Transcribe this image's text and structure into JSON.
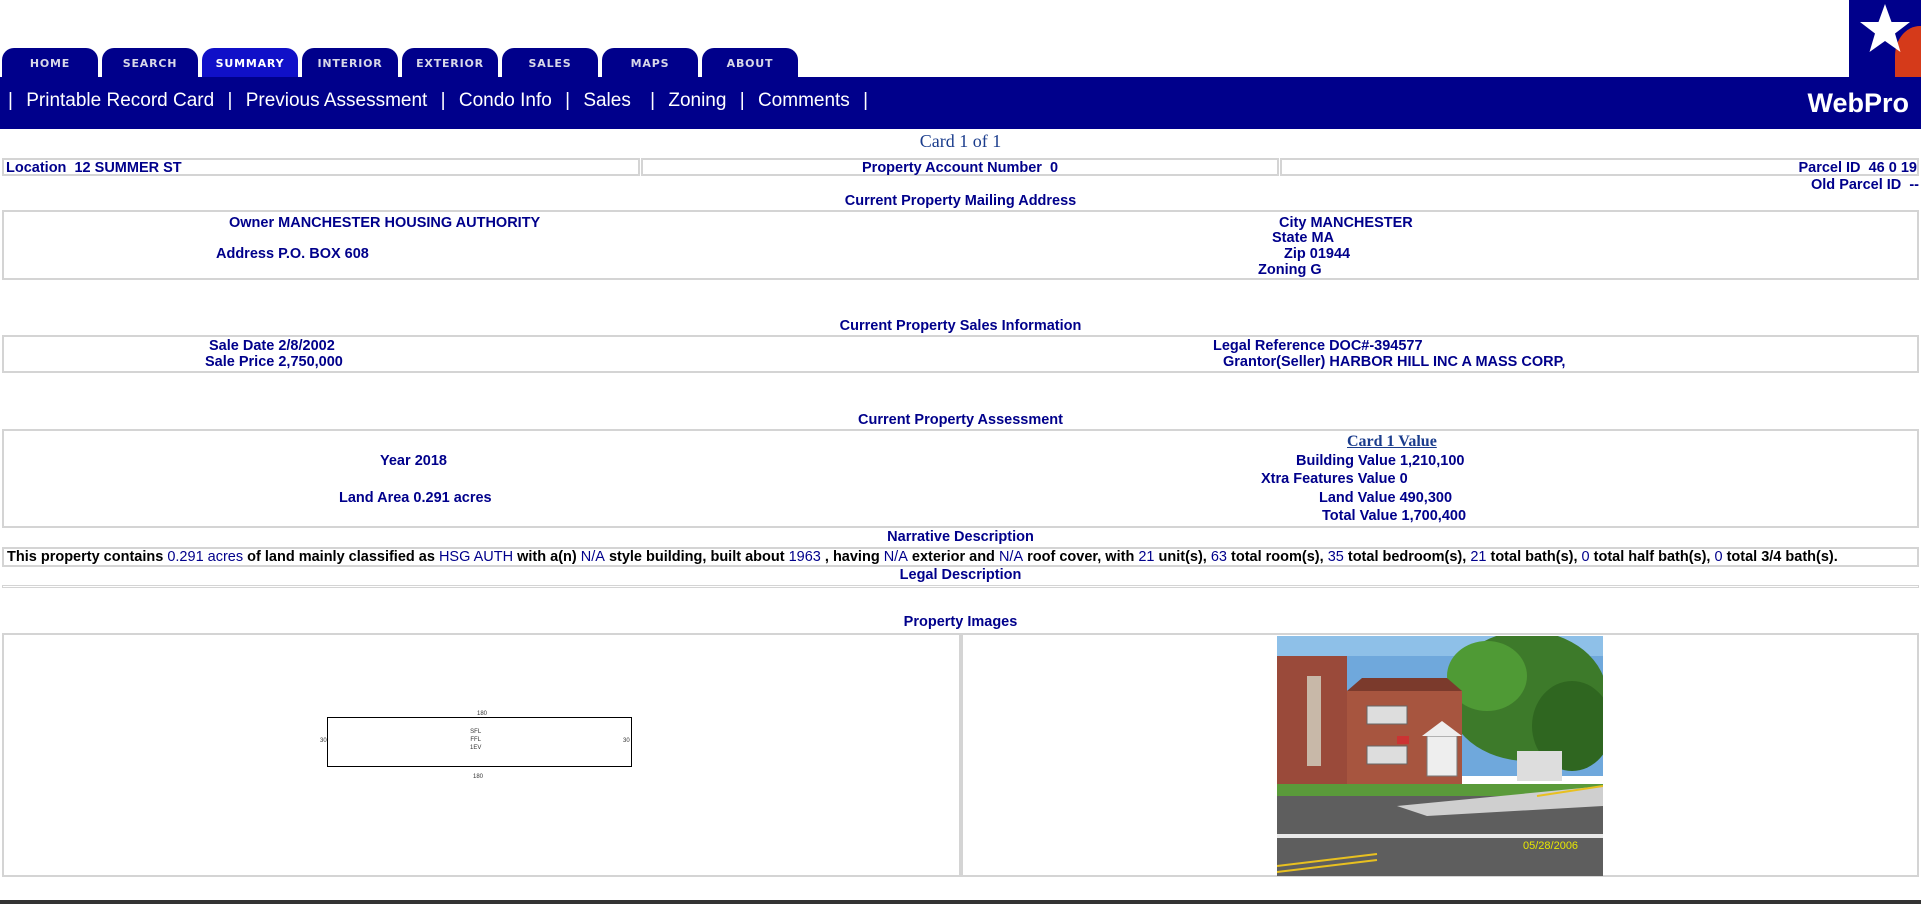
{
  "tabs": [
    "HOME",
    "SEARCH",
    "SUMMARY",
    "INTERIOR",
    "EXTERIOR",
    "SALES",
    "MAPS",
    "ABOUT"
  ],
  "active_tab": "SUMMARY",
  "menu": [
    "Printable Record Card",
    "Previous Assessment",
    "Condo Info",
    "Sales",
    "Zoning",
    "Comments"
  ],
  "brand": "WebPro",
  "card_title": "Card 1 of 1",
  "header": {
    "location_label": "Location",
    "location_value": "12 SUMMER ST",
    "account_label": "Property Account Number",
    "account_value": "0",
    "parcel_label": "Parcel ID",
    "parcel_value": "46 0 19",
    "old_parcel_label": "Old Parcel ID",
    "old_parcel_value": "--"
  },
  "mailing": {
    "title": "Current Property Mailing Address",
    "owner_label": "Owner",
    "owner_value": "MANCHESTER HOUSING AUTHORITY",
    "address_label": "Address",
    "address_value": "P.O. BOX 608",
    "city_label": "City",
    "city_value": "MANCHESTER",
    "state_label": "State",
    "state_value": "MA",
    "zip_label": "Zip",
    "zip_value": "01944",
    "zoning_label": "Zoning",
    "zoning_value": "G"
  },
  "sales": {
    "title": "Current Property Sales Information",
    "sale_date_label": "Sale Date",
    "sale_date_value": "2/8/2002",
    "sale_price_label": "Sale Price",
    "sale_price_value": "2,750,000",
    "legal_ref_label": "Legal Reference",
    "legal_ref_value": "DOC#-394577",
    "grantor_label": "Grantor(Seller)",
    "grantor_value": "HARBOR HILL INC A MASS CORP,"
  },
  "assessment": {
    "title": "Current Property Assessment",
    "year_label": "Year",
    "year_value": "2018",
    "land_area_label": "Land Area",
    "land_area_value": "0.291 acres",
    "card_value_title": "Card 1 Value",
    "building_label": "Building Value",
    "building_value": "1,210,100",
    "xtra_label": "Xtra Features Value",
    "xtra_value": "0",
    "land_label": "Land Value",
    "land_value": "490,300",
    "total_label": "Total Value",
    "total_value": "1,700,400"
  },
  "narrative": {
    "title": "Narrative Description",
    "p1": "This property contains ",
    "acres": "0.291 acres",
    "p2": " of land mainly classified as ",
    "classification": "HSG AUTH",
    "p3": " with a(n) ",
    "style": "N/A",
    "p4": " style building, built about ",
    "year_built": "1963",
    "p5": " , having ",
    "exterior": "N/A",
    "p6": " exterior and ",
    "roof": "N/A",
    "p7": " roof cover, with ",
    "units": "21",
    "p8": " unit(s), ",
    "rooms": "63",
    "p9": " total room(s), ",
    "bedrooms": "35",
    "p10": " total bedroom(s), ",
    "baths": "21",
    "p11": " total bath(s), ",
    "half_baths": "0",
    "p12": " total half bath(s), ",
    "three_quarter_baths": "0",
    "p13": " total 3/4 bath(s)."
  },
  "legal_title": "Legal Description",
  "images_title": "Property Images",
  "sketch": {
    "top_dim": "180",
    "bottom_dim": "180",
    "left_dim": "30",
    "right_dim": "30",
    "labels": [
      "SFL",
      "FFL",
      "1EV"
    ]
  },
  "photo": {
    "date_stamp": "05/28/2006"
  }
}
